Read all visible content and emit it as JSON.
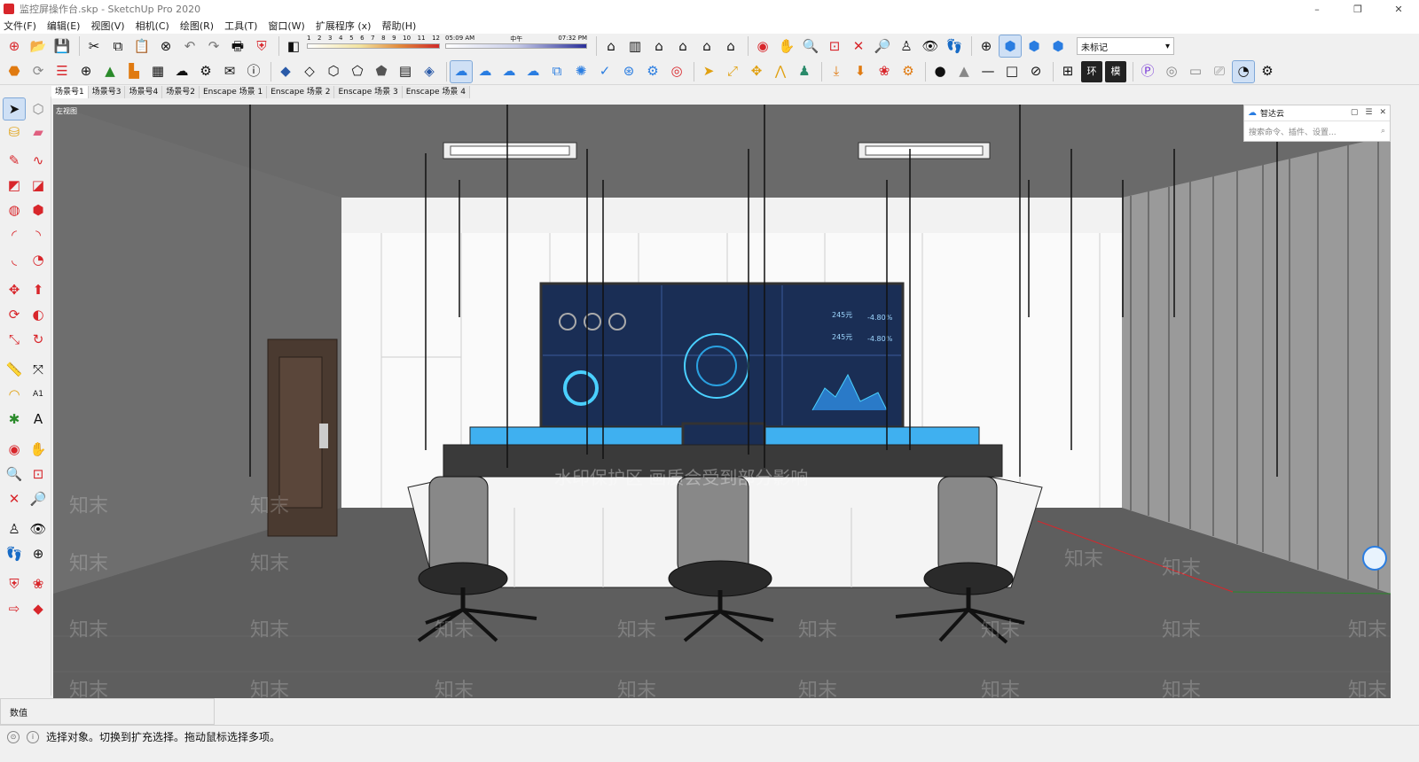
{
  "window": {
    "title": "监控屏操作台.skp - SketchUp Pro 2020",
    "controls": [
      "–",
      "❐",
      "✕"
    ]
  },
  "menu": [
    "文件(F)",
    "编辑(E)",
    "视图(V)",
    "相机(C)",
    "绘图(R)",
    "工具(T)",
    "窗口(W)",
    "扩展程序 (x)",
    "帮助(H)"
  ],
  "shadow": {
    "months": [
      "1",
      "2",
      "3",
      "4",
      "5",
      "6",
      "7",
      "8",
      "9",
      "10",
      "11",
      "12"
    ],
    "time_start": "05:09 AM",
    "time_mid": "中午",
    "time_end": "07:32 PM"
  },
  "tag_select": {
    "value": "未标记"
  },
  "scenes": [
    "场景号1",
    "场景号3",
    "场景号4",
    "场景号2",
    "Enscape 场景 1",
    "Enscape 场景 2",
    "Enscape 场景 3",
    "Enscape 场景 4"
  ],
  "viewport": {
    "view_label": "左视图",
    "watermark_text": "水印保护区  画质会受到部分影响",
    "watermark_brand": "知末",
    "screen_values": [
      "245元",
      "-4.80%",
      "245元",
      "-4.80%"
    ]
  },
  "plugin_panel": {
    "title": "智达云",
    "search_placeholder": "搜索命令、插件、设置..."
  },
  "measurements": {
    "label": "数值"
  },
  "status": {
    "text": "选择对象。切换到扩充选择。拖动鼠标选择多项。"
  },
  "colors": {
    "accent": "#1f7fd6",
    "wall": "#6b6b6b",
    "panel_white": "#fafafa",
    "desk_blue": "#3fb0f0",
    "screen_dark": "#1a2e55",
    "door": "#4a3a30"
  }
}
